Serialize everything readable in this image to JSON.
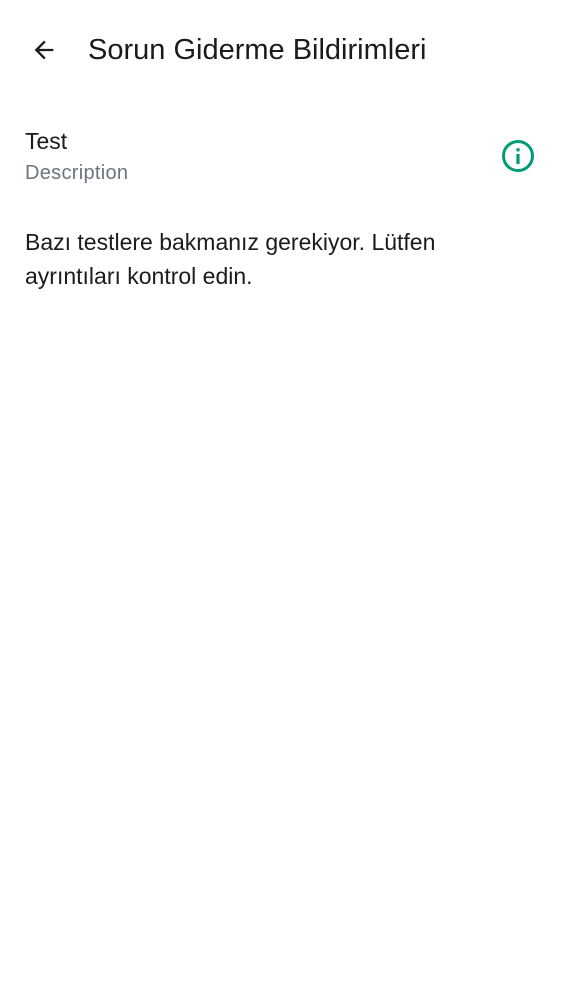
{
  "header": {
    "title": "Sorun Giderme Bildirimleri",
    "back_icon": "arrow-back-icon"
  },
  "item": {
    "title": "Test",
    "description": "Description",
    "info_icon": "info-icon",
    "accent_color": "#009b77"
  },
  "message": {
    "text": "Bazı testlere bakmanız gerekiyor. Lütfen ayrıntıları kontrol edin."
  }
}
